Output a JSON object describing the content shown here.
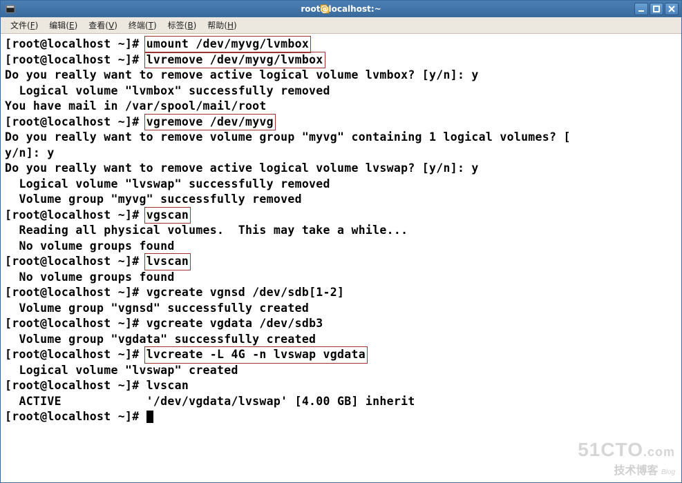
{
  "window": {
    "title": "root@localhost:~"
  },
  "menubar": {
    "items": [
      {
        "label": "文件",
        "accel": "F"
      },
      {
        "label": "编辑",
        "accel": "E"
      },
      {
        "label": "查看",
        "accel": "V"
      },
      {
        "label": "终端",
        "accel": "T"
      },
      {
        "label": "标签",
        "accel": "B"
      },
      {
        "label": "帮助",
        "accel": "H"
      }
    ]
  },
  "terminal": {
    "prompt": "[root@localhost ~]# ",
    "lines": [
      {
        "prompt": true,
        "cmd": "umount /dev/myvg/lvmbox",
        "hl": true
      },
      {
        "prompt": true,
        "cmd": "lvremove /dev/myvg/lvmbox",
        "hl": true
      },
      {
        "text": "Do you really want to remove active logical volume lvmbox? [y/n]: y"
      },
      {
        "text": "  Logical volume \"lvmbox\" successfully removed"
      },
      {
        "text": "You have mail in /var/spool/mail/root"
      },
      {
        "prompt": true,
        "cmd": "vgremove /dev/myvg",
        "hl": true
      },
      {
        "text": "Do you really want to remove volume group \"myvg\" containing 1 logical volumes? ["
      },
      {
        "text": "y/n]: y"
      },
      {
        "text": "Do you really want to remove active logical volume lvswap? [y/n]: y"
      },
      {
        "text": "  Logical volume \"lvswap\" successfully removed"
      },
      {
        "text": "  Volume group \"myvg\" successfully removed"
      },
      {
        "prompt": true,
        "cmd": "vgscan",
        "hl": true
      },
      {
        "text": "  Reading all physical volumes.  This may take a while..."
      },
      {
        "text": "  No volume groups found"
      },
      {
        "prompt": true,
        "cmd": "lvscan",
        "hl": true
      },
      {
        "text": "  No volume groups found"
      },
      {
        "prompt": true,
        "cmd": "vgcreate vgnsd /dev/sdb[1-2]",
        "hl": false
      },
      {
        "text": "  Volume group \"vgnsd\" successfully created"
      },
      {
        "prompt": true,
        "cmd": "vgcreate vgdata /dev/sdb3",
        "hl": false
      },
      {
        "text": "  Volume group \"vgdata\" successfully created"
      },
      {
        "prompt": true,
        "cmd": "lvcreate -L 4G -n lvswap vgdata",
        "hl": true
      },
      {
        "text": "  Logical volume \"lvswap\" created"
      },
      {
        "prompt": true,
        "cmd": "lvscan",
        "hl": false
      },
      {
        "text": "  ACTIVE            '/dev/vgdata/lvswap' [4.00 GB] inherit"
      },
      {
        "prompt": true,
        "cmd": "",
        "hl": false,
        "cursor": true
      }
    ]
  },
  "watermark": {
    "brand": "51CTO",
    "suffix": ".com",
    "tagline": "技术博客",
    "blog": "Blog"
  }
}
